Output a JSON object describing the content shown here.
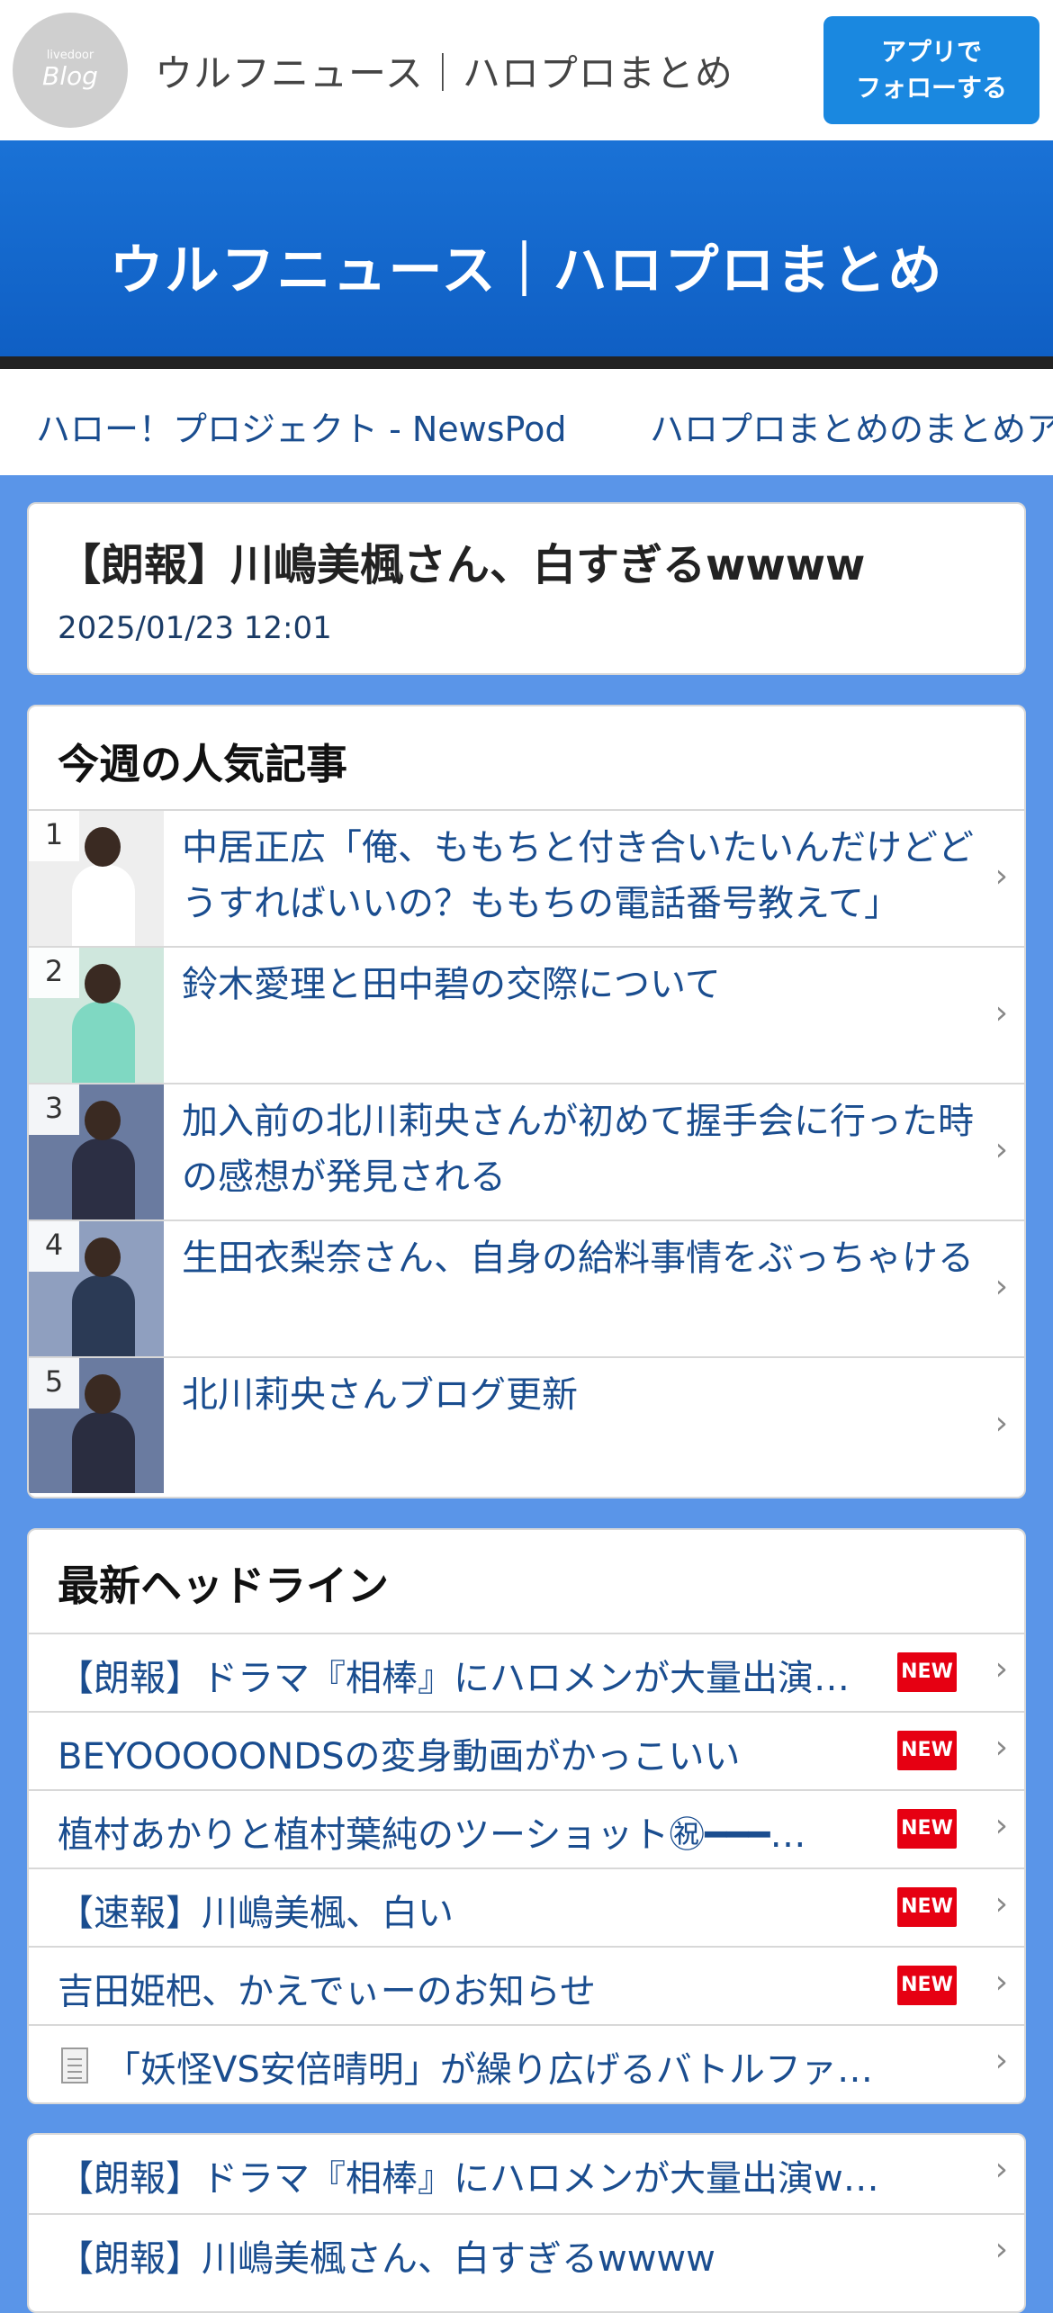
{
  "appbar": {
    "logo_small": "livedoor",
    "logo_big": "Blog",
    "title": "ウルフニュース｜ハロプロまとめ",
    "follow_button": "アプリで\nフォローする"
  },
  "hero": {
    "title": "ウルフニュース｜ハロプロまとめ"
  },
  "ticker": {
    "items": [
      "ハロー！プロジェクト - NewsPod",
      "ハロプロまとめのまとめア"
    ]
  },
  "article": {
    "title": "【朗報】川嶋美楓さん、白すぎるwwww",
    "date": "2025/01/23 12:01"
  },
  "popular": {
    "title": "今週の人気記事",
    "items": [
      {
        "rank": "1",
        "text": "中居正広「俺、ももちと付き合いたいんだけどどうすればいいの？ももちの電話番号教えて」",
        "thumb_color": "#eeeeee",
        "body_color": "#ffffff"
      },
      {
        "rank": "2",
        "text": "鈴木愛理と田中碧の交際について",
        "thumb_color": "#cfe7dd",
        "body_color": "#7fd8c2"
      },
      {
        "rank": "3",
        "text": "加入前の北川莉央さんが初めて握手会に行った時の感想が発見される",
        "thumb_color": "#6a7ba0",
        "body_color": "#2c2f44"
      },
      {
        "rank": "4",
        "text": "生田衣梨奈さん、自身の給料事情をぶっちゃける",
        "thumb_color": "#8f9fbf",
        "body_color": "#2b3a55"
      },
      {
        "rank": "5",
        "text": "北川莉央さんブログ更新",
        "thumb_color": "#6a7ba0",
        "body_color": "#2a2d40"
      }
    ]
  },
  "headlines": {
    "title": "最新ヘッドライン",
    "new_label": "NEW",
    "items": [
      {
        "text": "【朗報】ドラマ『相棒』にハロメンが大量出演…",
        "new": true
      },
      {
        "text": "BEYOOOOONDSの変身動画がかっこいい",
        "new": true
      },
      {
        "text": "植村あかりと植村葉純のツーショット㊗━━━…",
        "new": true
      },
      {
        "text": "【速報】川嶋美楓、白い",
        "new": true
      },
      {
        "text": "吉田姫杷、かえでぃーのお知らせ",
        "new": true
      },
      {
        "text": "「妖怪VS安倍晴明」が繰り広げるバトルファ…",
        "new": false
      }
    ]
  },
  "related": {
    "items": [
      "【朗報】ドラマ『相棒』にハロメンが大量出演w…",
      "【朗報】川嶋美楓さん、白すぎるwwww"
    ]
  }
}
